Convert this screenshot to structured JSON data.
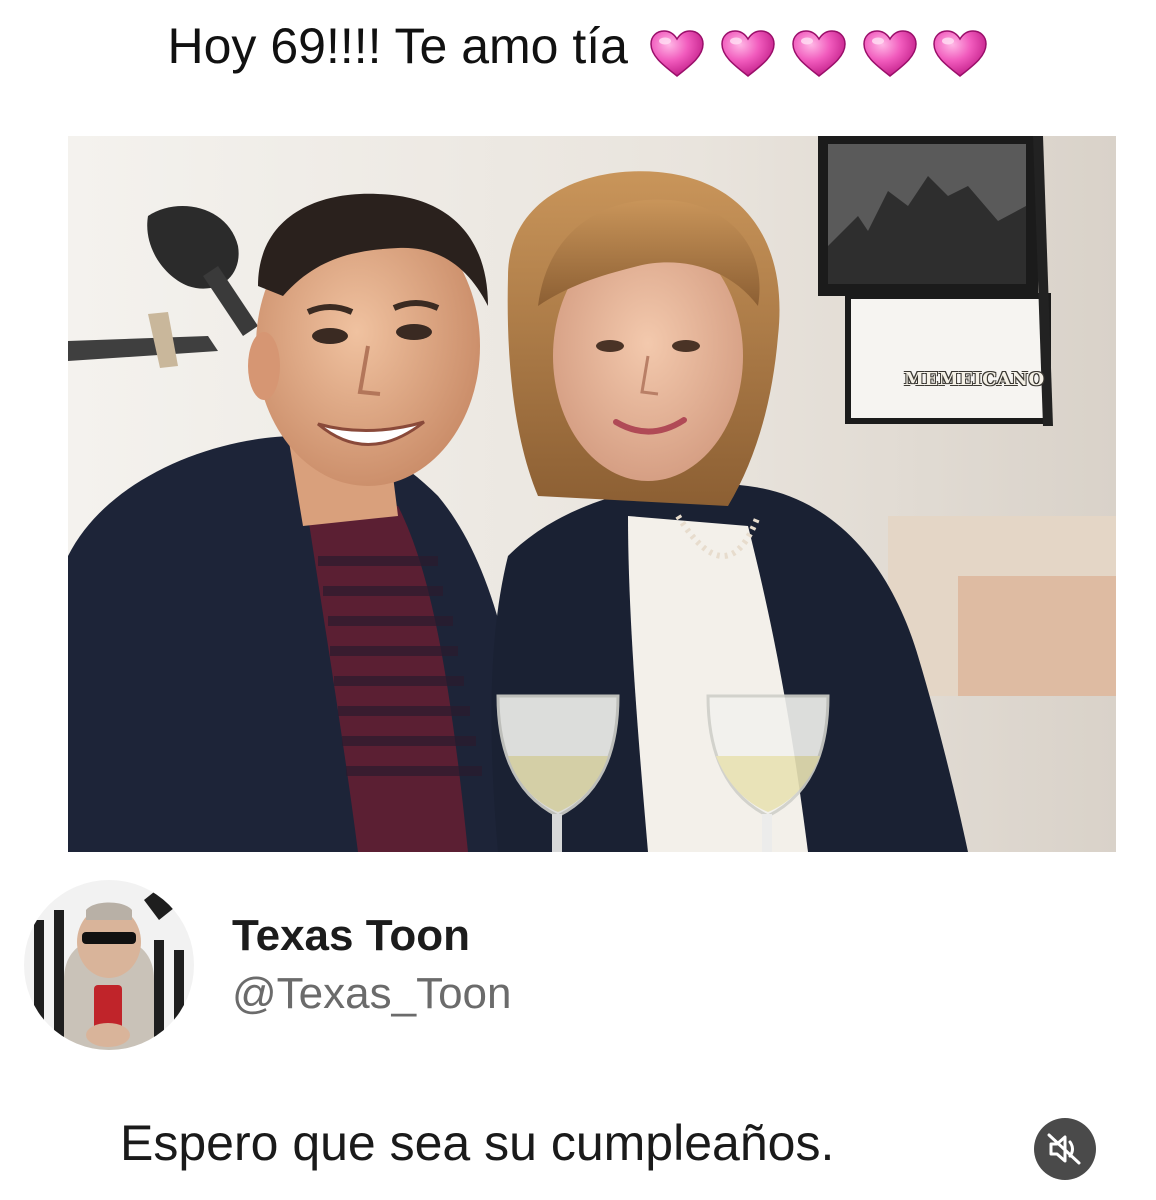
{
  "caption": {
    "text": "Hoy 69!!!! Te amo tía",
    "heart_icons": [
      "pink-heart-icon",
      "pink-heart-icon",
      "pink-heart-icon",
      "pink-heart-icon",
      "pink-heart-icon"
    ],
    "heart_color": "#e040a8"
  },
  "photo": {
    "watermark": "MEMEICANO"
  },
  "tweet": {
    "author_name": "Texas Toon",
    "author_handle": "@Texas_Toon",
    "text": "Espero que sea su cumpleaños."
  },
  "controls": {
    "mute_icon": "volume-muted-icon"
  },
  "colors": {
    "background": "#ffffff",
    "mute_button": "#4a4a4a",
    "handle_text": "#6b6b6b"
  }
}
